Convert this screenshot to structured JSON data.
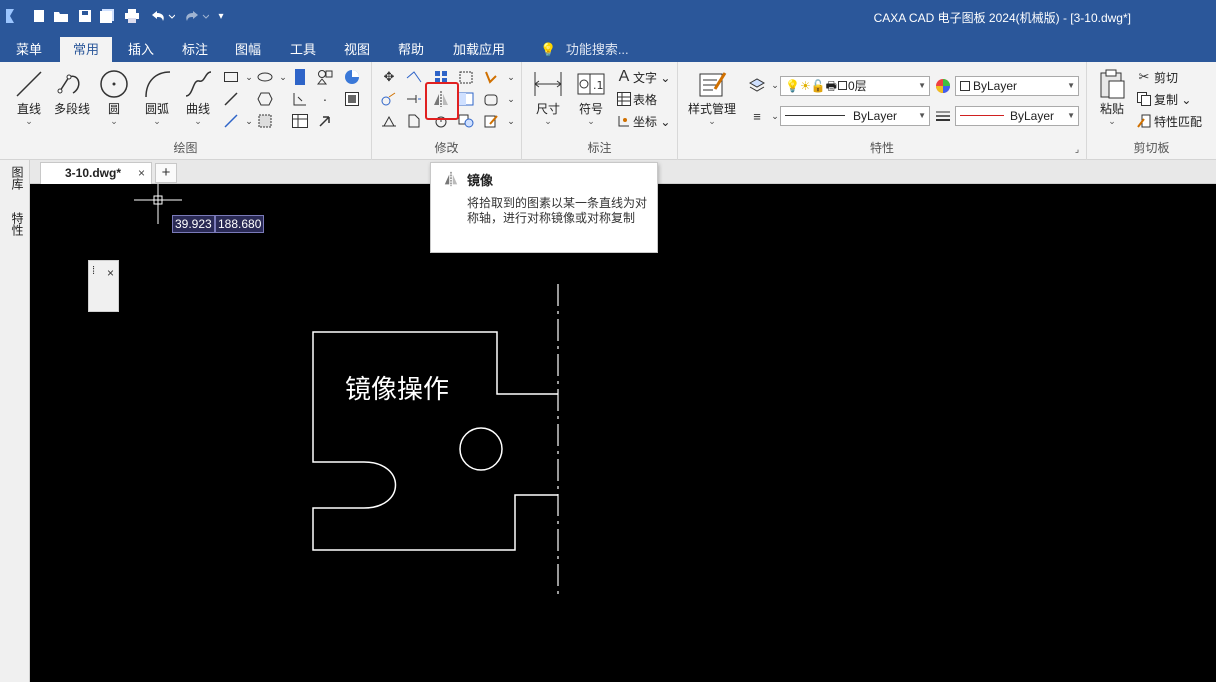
{
  "window": {
    "title": "CAXA CAD 电子图板 2024(机械版) - [3-10.dwg*]"
  },
  "menu_tabs": [
    "菜单",
    "常用",
    "插入",
    "标注",
    "图幅",
    "工具",
    "视图",
    "帮助",
    "加载应用"
  ],
  "active_tab": "常用",
  "search_placeholder": "功能搜索...",
  "ribbon": {
    "draw": {
      "label": "绘图",
      "line": "直线",
      "polyline": "多段线",
      "circle": "圆",
      "arc": "圆弧",
      "curve": "曲线"
    },
    "modify": {
      "label": "修改"
    },
    "annotate": {
      "label": "标注",
      "dimension": "尺寸",
      "symbol": "符号",
      "text": "文字",
      "table": "表格",
      "coordinate": "坐标"
    },
    "properties": {
      "label": "特性",
      "style_manager": "样式管理",
      "layer": "0层",
      "color": "ByLayer",
      "linetype": "ByLayer",
      "lineweight": "ByLayer"
    },
    "clipboard": {
      "label": "剪切板",
      "paste": "粘贴",
      "cut": "剪切",
      "copy": "复制",
      "match_props": "特性匹配"
    }
  },
  "doc_tab": {
    "name": "3-10.dwg*",
    "close": "×",
    "new": "+"
  },
  "left_panel": {
    "library": "图库",
    "properties": "特性"
  },
  "canvas": {
    "coord_x": "39.923",
    "coord_y": "188.680",
    "minipanel_close": "×",
    "drawing_text": "镜像操作"
  },
  "tooltip": {
    "title": "镜像",
    "description": "将拾取到的图素以某一条直线为对称轴，进行对称镜像或对称复制"
  },
  "colors": {
    "titlebar": "#2b579a",
    "canvas": "#000000",
    "highlight": "#e02020"
  }
}
